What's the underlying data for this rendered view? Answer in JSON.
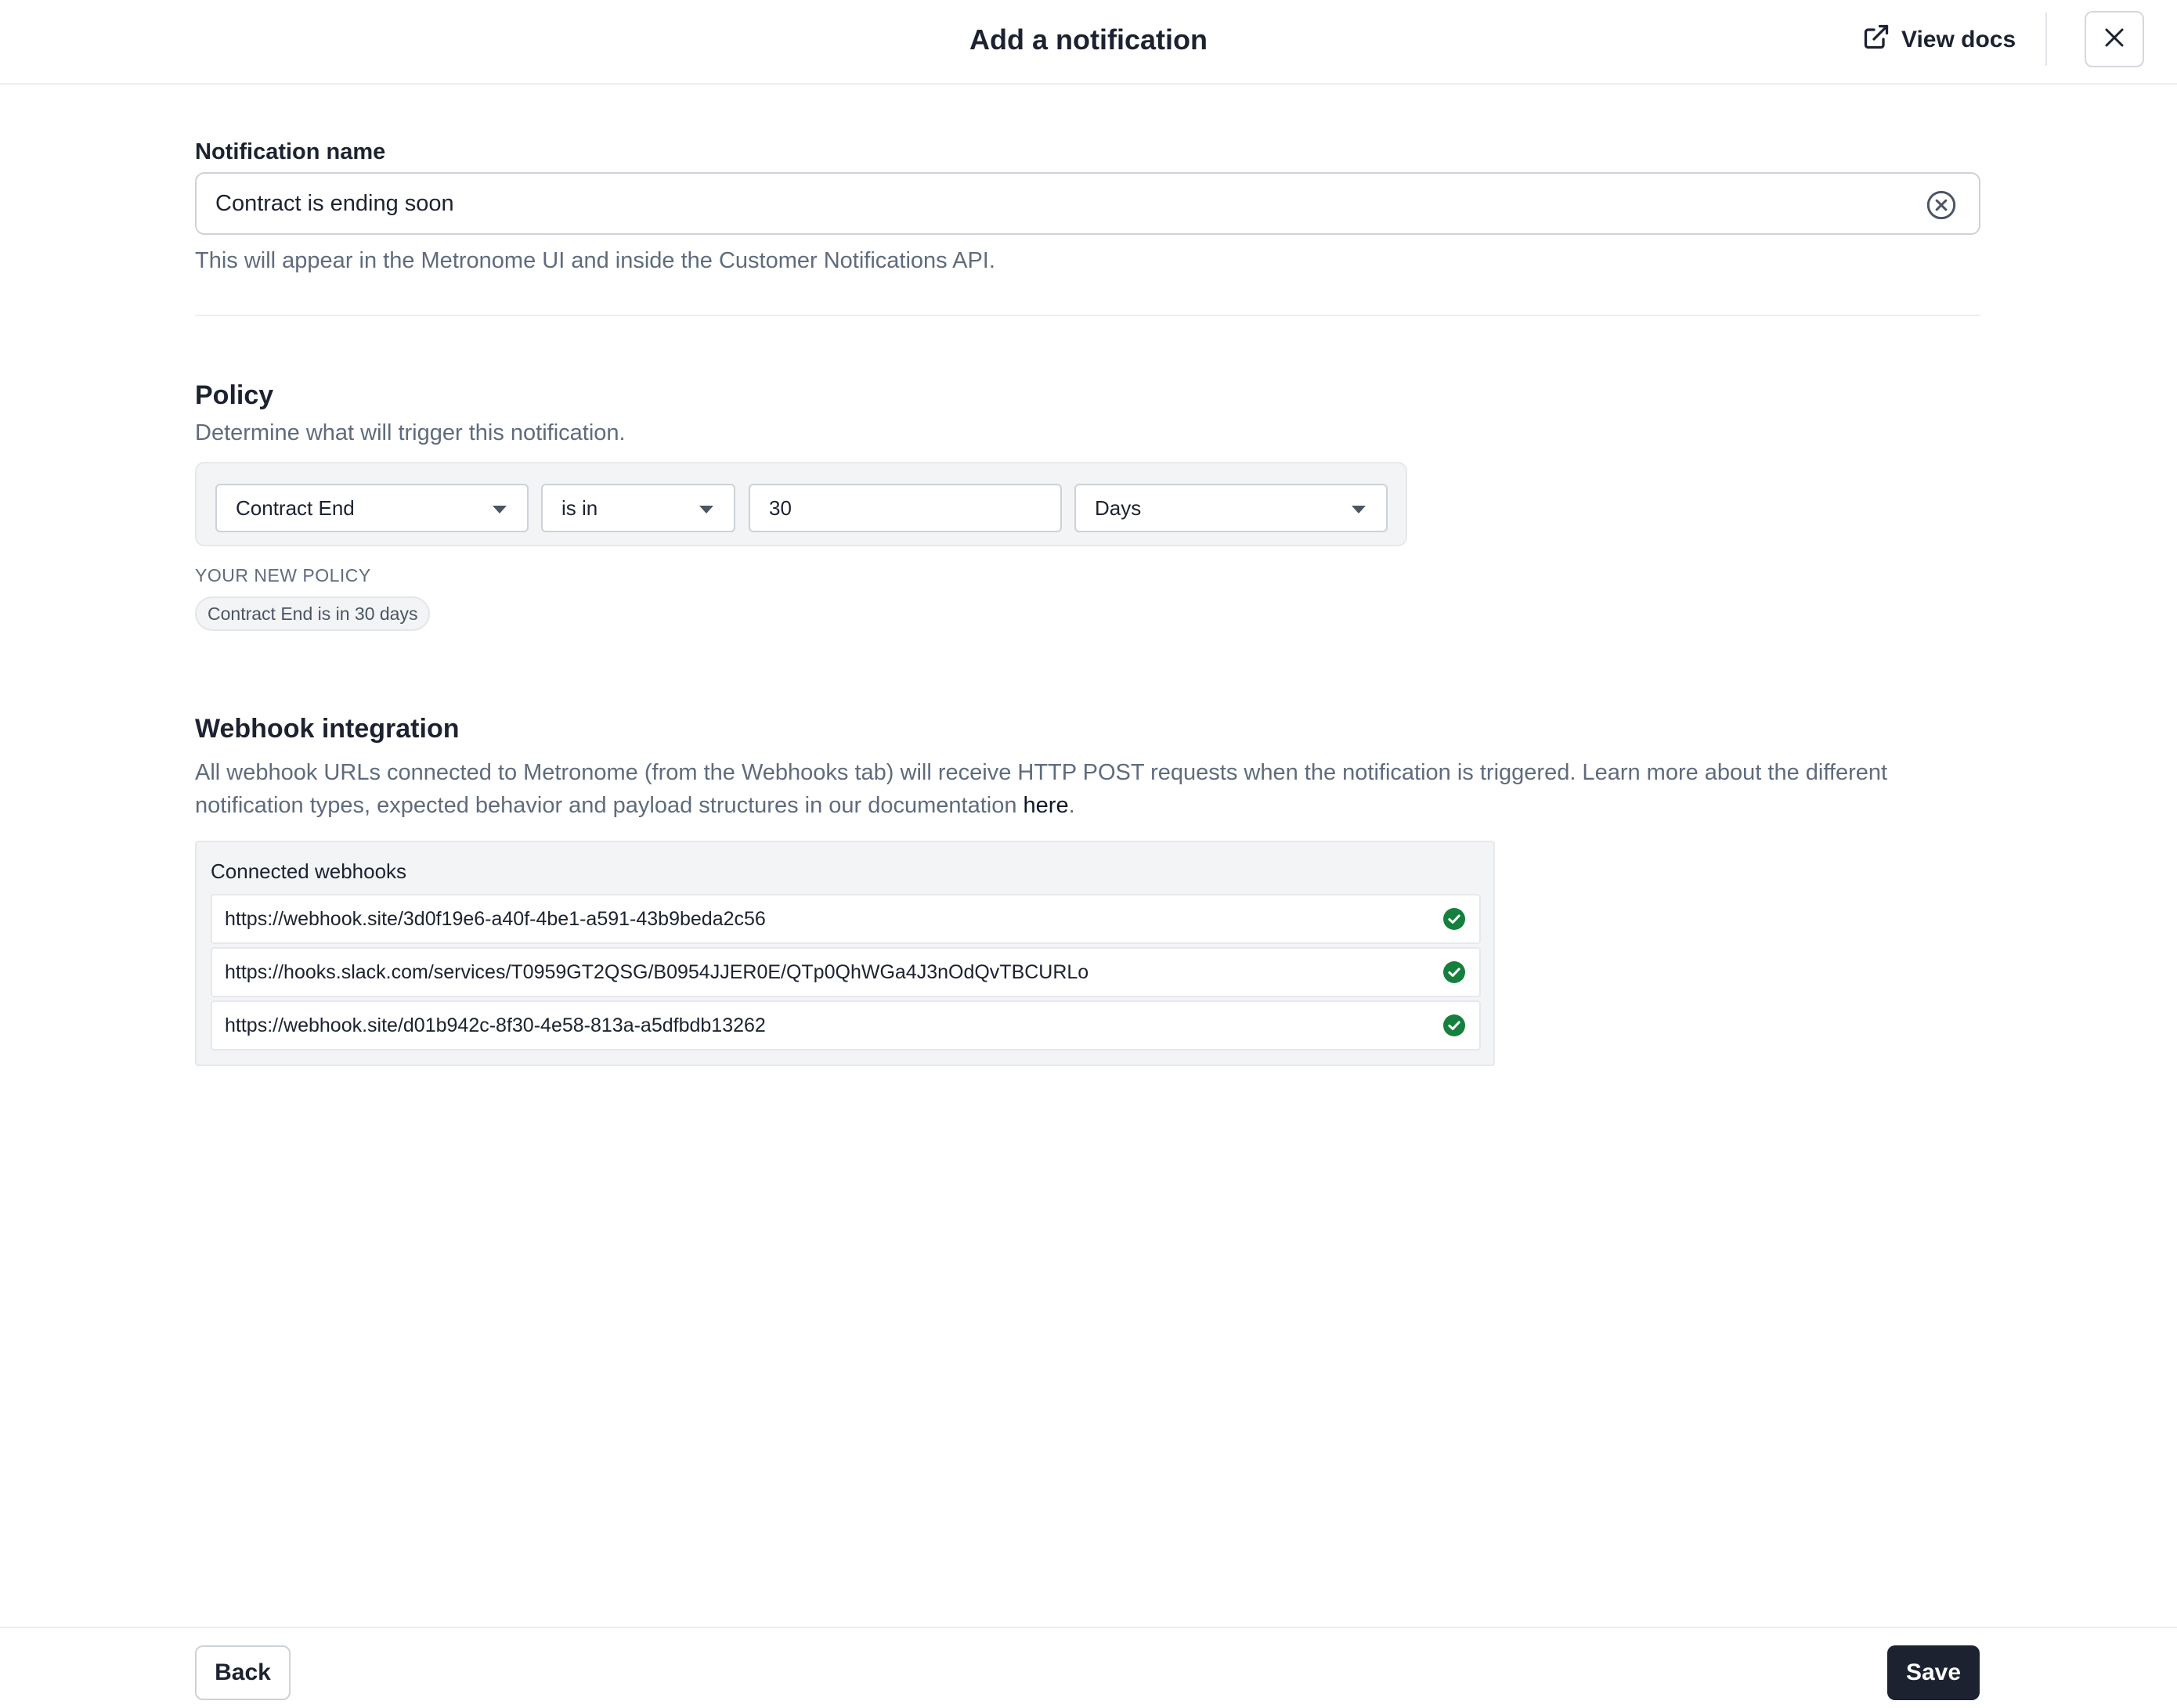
{
  "header": {
    "title": "Add a notification",
    "view_docs_label": "View docs",
    "view_docs_icon": "external-link-icon",
    "close_icon": "close-icon"
  },
  "notification_name": {
    "label": "Notification name",
    "value": "Contract is ending soon",
    "clear_icon": "clear-circle-icon",
    "help_text": "This will appear in the Metronome UI and inside the Customer Notifications API."
  },
  "policy": {
    "title": "Policy",
    "description": "Determine what will trigger this notification.",
    "trigger_select": "Contract End",
    "operator_select": "is in",
    "amount_value": "30",
    "unit_select": "Days",
    "summary_caption": "YOUR NEW POLICY",
    "summary_chip": "Contract End is in 30 days"
  },
  "webhooks": {
    "title": "Webhook integration",
    "description_prefix": "All webhook URLs connected to Metronome (from the Webhooks tab) will receive HTTP POST requests when the notification is triggered. Learn more about the different notification types, expected behavior and payload structures in our documentation ",
    "description_link": "here",
    "description_suffix": ".",
    "panel_title": "Connected webhooks",
    "items": [
      {
        "url": "https://webhook.site/3d0f19e6-a40f-4be1-a591-43b9beda2c56",
        "status_icon": "check-circle-icon"
      },
      {
        "url": "https://hooks.slack.com/services/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",
        "status_icon": "check-circle-icon"
      },
      {
        "url": "https://webhook.site/d01b942c-8f30-4e58-813a-a5dfbdb13262",
        "status_icon": "check-circle-icon"
      }
    ],
    "status_color": "#15803d"
  },
  "footer": {
    "back_label": "Back",
    "save_label": "Save"
  },
  "colors": {
    "primary_dark": "#1c2230",
    "muted_text": "#5f6b7d",
    "panel_bg": "#f3f4f6"
  }
}
